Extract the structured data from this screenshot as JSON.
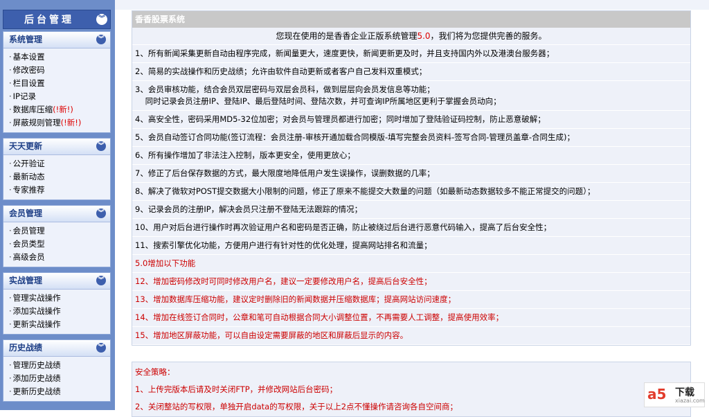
{
  "sidebar": {
    "title": "后台管理",
    "toggle_glyph": "︾",
    "menus": [
      {
        "title": "系统管理",
        "items": [
          {
            "label": "基本设置",
            "new": ""
          },
          {
            "label": "修改密码",
            "new": ""
          },
          {
            "label": "栏目设置",
            "new": ""
          },
          {
            "label": "IP记录",
            "new": ""
          },
          {
            "label": "数据库压缩",
            "new": "(!新!)"
          },
          {
            "label": "屏蔽规则管理",
            "new": "(!新!)"
          }
        ]
      },
      {
        "title": "天天更新",
        "items": [
          {
            "label": "公开验证",
            "new": ""
          },
          {
            "label": "最新动态",
            "new": ""
          },
          {
            "label": "专家推荐",
            "new": ""
          }
        ]
      },
      {
        "title": "会员管理",
        "items": [
          {
            "label": "会员管理",
            "new": ""
          },
          {
            "label": "会员类型",
            "new": ""
          },
          {
            "label": "高级会员",
            "new": ""
          }
        ]
      },
      {
        "title": "实战管理",
        "items": [
          {
            "label": "管理实战操作",
            "new": ""
          },
          {
            "label": "添加实战操作",
            "new": ""
          },
          {
            "label": "更新实战操作",
            "new": ""
          }
        ]
      },
      {
        "title": "历史战绩",
        "items": [
          {
            "label": "管理历史战绩",
            "new": ""
          },
          {
            "label": "添加历史战绩",
            "new": ""
          },
          {
            "label": "更新历史战绩",
            "new": ""
          }
        ]
      }
    ]
  },
  "main": {
    "panel_title": "香香股票系统",
    "welcome_pre": "您现在使用的是香香企业正版系统管理",
    "welcome_ver": "5.0",
    "welcome_post": "，我们将为您提供完善的服务。",
    "features": [
      {
        "text": "1、所有新闻采集更新自动由程序完成，新闻量更大，速度更快，新闻更新更及时，并且支持国内外以及港澳台服务器；",
        "red": false
      },
      {
        "text": "2、简易的实战操作和历史战绩；允许由软件自动更新或者客户自己发料双重模式；",
        "red": false
      },
      {
        "text": "3、会员审核功能，结合会员双层密码与双层会员科，做到层层向会员发信息等功能；\n    同时记录会员注册IP、登陆IP、最后登陆时间、登陆次数，并可查询IP所属地区更利于掌握会员动向；",
        "red": false
      },
      {
        "text": "4、高安全性，密码采用MD5-32位加密；对会员与管理员都进行加密；同时增加了登陆验证码控制，防止恶意破解；",
        "red": false
      },
      {
        "text": "5、会员自动签订合同功能(签订流程：会员注册-审核开通加载合同模版-填写完整会员资料-签写合同-管理员盖章-合同生成)；",
        "red": false
      },
      {
        "text": "6、所有操作增加了非法注入控制，版本更安全，使用更放心；",
        "red": false
      },
      {
        "text": "7、修正了后台保存数据的方式，最大限度地降低用户发生误操作，误删数据的几率；",
        "red": false
      },
      {
        "text": "8、解决了微软对POST提交数据大小限制的问题，修正了原来不能提交大数量的问题（如最新动态数据较多不能正常提交的问题）；",
        "red": false
      },
      {
        "text": "9、记录会员的注册IP，解决会员只注册不登陆无法跟踪的情况；",
        "red": false
      },
      {
        "text": "10、用户对后台进行操作时再次验证用户名和密码是否正确，防止被绕过后台进行恶意代码输入，提高了后台安全性；",
        "red": false
      },
      {
        "text": "11、搜索引擎优化功能，方便用户进行有针对性的优化处理，提高网站排名和流量；",
        "red": false
      },
      {
        "text": "5.0增加以下功能",
        "red": true
      },
      {
        "text": "12、增加密码修改时可同时修改用户名，建议一定要修改用户名，提高后台安全性；",
        "red": true
      },
      {
        "text": "13、增加数据库压缩功能，建议定时删除旧的新闻数据并压缩数据库；提高网站访问速度；",
        "red": true
      },
      {
        "text": "14、增加在线签订合同时，公章和笔可自动根据合同大小调整位置，不再需要人工调整，提高使用效率；",
        "red": true
      },
      {
        "text": "15、增加地区屏蔽功能，可以自由设定需要屏蔽的地区和屏蔽后显示的内容。",
        "red": true
      }
    ],
    "security_title": "安全策略：",
    "security_items": [
      "1、上传完版本后请及时关闭FTP，并修改网站后台密码；",
      "2、关闭整站的写权限，单独开启data的写权限，关于以上2点不懂操作请咨询各自空间商；"
    ]
  },
  "watermark": {
    "logo": "a5",
    "text": "下载",
    "url": "xiazai.com"
  }
}
